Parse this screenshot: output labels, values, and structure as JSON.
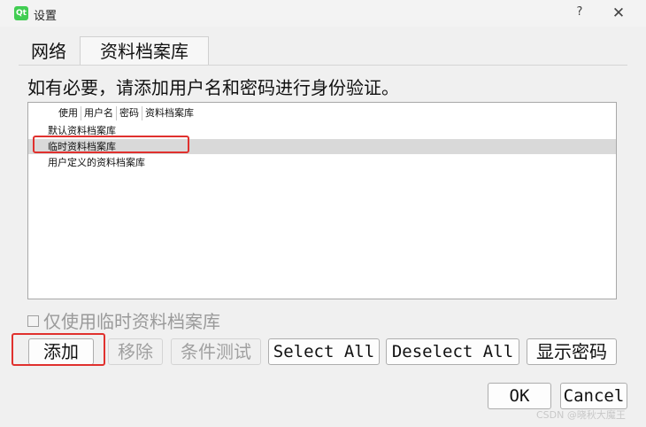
{
  "window": {
    "app_icon": "Qt",
    "title": "设置",
    "help_label": "?",
    "close_label": "✕"
  },
  "tabs": [
    {
      "label": "网络"
    },
    {
      "label": "资料档案库"
    }
  ],
  "instruction": "如有必要，请添加用户名和密码进行身份验证。",
  "list": {
    "columns": [
      "使用",
      "用户名",
      "密码",
      "资料档案库"
    ],
    "items": [
      {
        "label": "默认资料档案库"
      },
      {
        "label": "临时资料档案库"
      },
      {
        "label": "用户定义的资料档案库"
      }
    ]
  },
  "checkbox": {
    "label": "仅使用临时资料档案库",
    "checked": false
  },
  "buttons": {
    "add": "添加",
    "remove": "移除",
    "test": "条件测试",
    "select_all": "Select All",
    "deselect_all": "Deselect All",
    "show_password": "显示密码",
    "ok": "OK",
    "cancel": "Cancel"
  },
  "watermark": "CSDN @晓秋大魔王",
  "colors": {
    "highlight_border": "#e0312e",
    "selected_row": "#d9d9d9",
    "qt_icon": "#41cd52"
  }
}
